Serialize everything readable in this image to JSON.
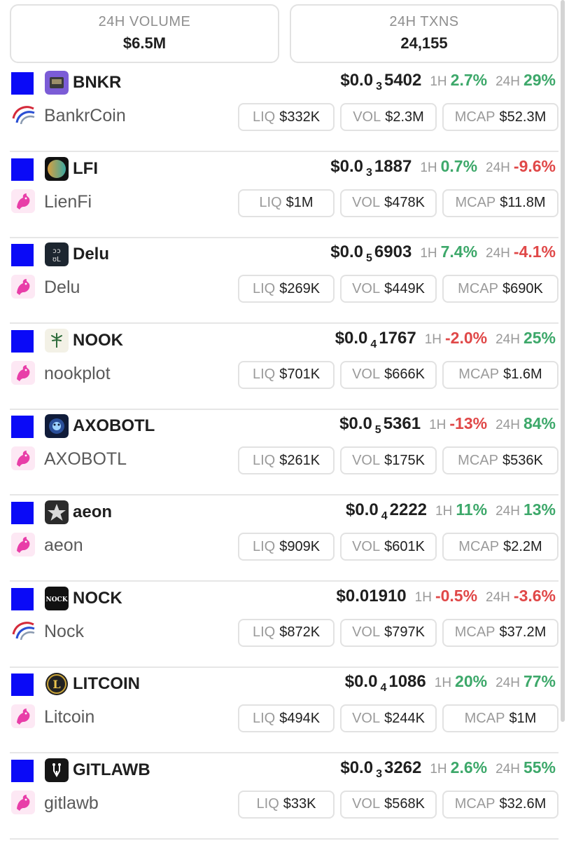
{
  "stats": {
    "volume_label": "24H VOLUME",
    "volume_value": "$6.5M",
    "txns_label": "24H TXNS",
    "txns_value": "24,155"
  },
  "labels": {
    "h1": "1H",
    "h24": "24H",
    "liq": "LIQ",
    "vol": "VOL",
    "mcap": "MCAP"
  },
  "colors": {
    "up": "#3da86a",
    "down": "#e04848",
    "square": "#0a0af7"
  },
  "tokens": [
    {
      "symbol": "BNKR",
      "name": "BankrCoin",
      "price_prefix": "$0.0",
      "price_sub": "3",
      "price_rest": "5402",
      "change_1h": "2.7%",
      "change_1h_dir": "up",
      "change_24h": "29%",
      "change_24h_dir": "up",
      "liq": "$332K",
      "vol": "$2.3M",
      "mcap": "$52.3M",
      "token_icon": "bankr-logo-icon",
      "dex_icon": "base-swoosh-icon"
    },
    {
      "symbol": "LFI",
      "name": "LienFi",
      "price_prefix": "$0.0",
      "price_sub": "3",
      "price_rest": "1887",
      "change_1h": "0.7%",
      "change_1h_dir": "up",
      "change_24h": "-9.6%",
      "change_24h_dir": "down",
      "liq": "$1M",
      "vol": "$478K",
      "mcap": "$11.8M",
      "token_icon": "lienfi-logo-icon",
      "dex_icon": "uniswap-unicorn-icon"
    },
    {
      "symbol": "Delu",
      "name": "Delu",
      "price_prefix": "$0.0",
      "price_sub": "5",
      "price_rest": "6903",
      "change_1h": "7.4%",
      "change_1h_dir": "up",
      "change_24h": "-4.1%",
      "change_24h_dir": "down",
      "liq": "$269K",
      "vol": "$449K",
      "mcap": "$690K",
      "token_icon": "delu-logo-icon",
      "dex_icon": "uniswap-unicorn-icon"
    },
    {
      "symbol": "NOOK",
      "name": "nookplot",
      "price_prefix": "$0.0",
      "price_sub": "4",
      "price_rest": "1767",
      "change_1h": "-2.0%",
      "change_1h_dir": "down",
      "change_24h": "25%",
      "change_24h_dir": "up",
      "liq": "$701K",
      "vol": "$666K",
      "mcap": "$1.6M",
      "token_icon": "nook-tree-icon",
      "dex_icon": "uniswap-unicorn-icon"
    },
    {
      "symbol": "AXOBOTL",
      "name": "AXOBOTL",
      "price_prefix": "$0.0",
      "price_sub": "5",
      "price_rest": "5361",
      "change_1h": "-13%",
      "change_1h_dir": "down",
      "change_24h": "84%",
      "change_24h_dir": "up",
      "liq": "$261K",
      "vol": "$175K",
      "mcap": "$536K",
      "token_icon": "axobotl-logo-icon",
      "dex_icon": "uniswap-unicorn-icon"
    },
    {
      "symbol": "aeon",
      "name": "aeon",
      "price_prefix": "$0.0",
      "price_sub": "4",
      "price_rest": "2222",
      "change_1h": "11%",
      "change_1h_dir": "up",
      "change_24h": "13%",
      "change_24h_dir": "up",
      "liq": "$909K",
      "vol": "$601K",
      "mcap": "$2.2M",
      "token_icon": "aeon-star-icon",
      "dex_icon": "uniswap-unicorn-icon"
    },
    {
      "symbol": "NOCK",
      "name": "Nock",
      "price_prefix": "$0.01910",
      "price_sub": "",
      "price_rest": "",
      "change_1h": "-0.5%",
      "change_1h_dir": "down",
      "change_24h": "-3.6%",
      "change_24h_dir": "down",
      "liq": "$872K",
      "vol": "$797K",
      "mcap": "$37.2M",
      "token_icon": "nock-logo-icon",
      "dex_icon": "base-swoosh-icon"
    },
    {
      "symbol": "LITCOIN",
      "name": "Litcoin",
      "price_prefix": "$0.0",
      "price_sub": "4",
      "price_rest": "1086",
      "change_1h": "20%",
      "change_1h_dir": "up",
      "change_24h": "77%",
      "change_24h_dir": "up",
      "liq": "$494K",
      "vol": "$244K",
      "mcap": "$1M",
      "token_icon": "litcoin-logo-icon",
      "dex_icon": "uniswap-unicorn-icon"
    },
    {
      "symbol": "GITLAWB",
      "name": "gitlawb",
      "price_prefix": "$0.0",
      "price_sub": "3",
      "price_rest": "3262",
      "change_1h": "2.6%",
      "change_1h_dir": "up",
      "change_24h": "55%",
      "change_24h_dir": "up",
      "liq": "$33K",
      "vol": "$568K",
      "mcap": "$32.6M",
      "token_icon": "gitlawb-logo-icon",
      "dex_icon": "uniswap-unicorn-icon"
    }
  ]
}
